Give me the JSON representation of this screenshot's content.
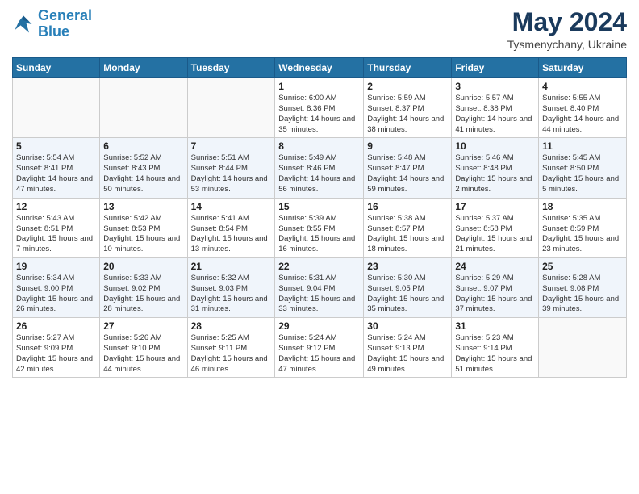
{
  "header": {
    "logo_line1": "General",
    "logo_line2": "Blue",
    "month": "May 2024",
    "location": "Tysmenychany, Ukraine"
  },
  "days_of_week": [
    "Sunday",
    "Monday",
    "Tuesday",
    "Wednesday",
    "Thursday",
    "Friday",
    "Saturday"
  ],
  "weeks": [
    [
      {
        "day": "",
        "sunrise": "",
        "sunset": "",
        "daylight": ""
      },
      {
        "day": "",
        "sunrise": "",
        "sunset": "",
        "daylight": ""
      },
      {
        "day": "",
        "sunrise": "",
        "sunset": "",
        "daylight": ""
      },
      {
        "day": "1",
        "sunrise": "Sunrise: 6:00 AM",
        "sunset": "Sunset: 8:36 PM",
        "daylight": "Daylight: 14 hours and 35 minutes."
      },
      {
        "day": "2",
        "sunrise": "Sunrise: 5:59 AM",
        "sunset": "Sunset: 8:37 PM",
        "daylight": "Daylight: 14 hours and 38 minutes."
      },
      {
        "day": "3",
        "sunrise": "Sunrise: 5:57 AM",
        "sunset": "Sunset: 8:38 PM",
        "daylight": "Daylight: 14 hours and 41 minutes."
      },
      {
        "day": "4",
        "sunrise": "Sunrise: 5:55 AM",
        "sunset": "Sunset: 8:40 PM",
        "daylight": "Daylight: 14 hours and 44 minutes."
      }
    ],
    [
      {
        "day": "5",
        "sunrise": "Sunrise: 5:54 AM",
        "sunset": "Sunset: 8:41 PM",
        "daylight": "Daylight: 14 hours and 47 minutes."
      },
      {
        "day": "6",
        "sunrise": "Sunrise: 5:52 AM",
        "sunset": "Sunset: 8:43 PM",
        "daylight": "Daylight: 14 hours and 50 minutes."
      },
      {
        "day": "7",
        "sunrise": "Sunrise: 5:51 AM",
        "sunset": "Sunset: 8:44 PM",
        "daylight": "Daylight: 14 hours and 53 minutes."
      },
      {
        "day": "8",
        "sunrise": "Sunrise: 5:49 AM",
        "sunset": "Sunset: 8:46 PM",
        "daylight": "Daylight: 14 hours and 56 minutes."
      },
      {
        "day": "9",
        "sunrise": "Sunrise: 5:48 AM",
        "sunset": "Sunset: 8:47 PM",
        "daylight": "Daylight: 14 hours and 59 minutes."
      },
      {
        "day": "10",
        "sunrise": "Sunrise: 5:46 AM",
        "sunset": "Sunset: 8:48 PM",
        "daylight": "Daylight: 15 hours and 2 minutes."
      },
      {
        "day": "11",
        "sunrise": "Sunrise: 5:45 AM",
        "sunset": "Sunset: 8:50 PM",
        "daylight": "Daylight: 15 hours and 5 minutes."
      }
    ],
    [
      {
        "day": "12",
        "sunrise": "Sunrise: 5:43 AM",
        "sunset": "Sunset: 8:51 PM",
        "daylight": "Daylight: 15 hours and 7 minutes."
      },
      {
        "day": "13",
        "sunrise": "Sunrise: 5:42 AM",
        "sunset": "Sunset: 8:53 PM",
        "daylight": "Daylight: 15 hours and 10 minutes."
      },
      {
        "day": "14",
        "sunrise": "Sunrise: 5:41 AM",
        "sunset": "Sunset: 8:54 PM",
        "daylight": "Daylight: 15 hours and 13 minutes."
      },
      {
        "day": "15",
        "sunrise": "Sunrise: 5:39 AM",
        "sunset": "Sunset: 8:55 PM",
        "daylight": "Daylight: 15 hours and 16 minutes."
      },
      {
        "day": "16",
        "sunrise": "Sunrise: 5:38 AM",
        "sunset": "Sunset: 8:57 PM",
        "daylight": "Daylight: 15 hours and 18 minutes."
      },
      {
        "day": "17",
        "sunrise": "Sunrise: 5:37 AM",
        "sunset": "Sunset: 8:58 PM",
        "daylight": "Daylight: 15 hours and 21 minutes."
      },
      {
        "day": "18",
        "sunrise": "Sunrise: 5:35 AM",
        "sunset": "Sunset: 8:59 PM",
        "daylight": "Daylight: 15 hours and 23 minutes."
      }
    ],
    [
      {
        "day": "19",
        "sunrise": "Sunrise: 5:34 AM",
        "sunset": "Sunset: 9:00 PM",
        "daylight": "Daylight: 15 hours and 26 minutes."
      },
      {
        "day": "20",
        "sunrise": "Sunrise: 5:33 AM",
        "sunset": "Sunset: 9:02 PM",
        "daylight": "Daylight: 15 hours and 28 minutes."
      },
      {
        "day": "21",
        "sunrise": "Sunrise: 5:32 AM",
        "sunset": "Sunset: 9:03 PM",
        "daylight": "Daylight: 15 hours and 31 minutes."
      },
      {
        "day": "22",
        "sunrise": "Sunrise: 5:31 AM",
        "sunset": "Sunset: 9:04 PM",
        "daylight": "Daylight: 15 hours and 33 minutes."
      },
      {
        "day": "23",
        "sunrise": "Sunrise: 5:30 AM",
        "sunset": "Sunset: 9:05 PM",
        "daylight": "Daylight: 15 hours and 35 minutes."
      },
      {
        "day": "24",
        "sunrise": "Sunrise: 5:29 AM",
        "sunset": "Sunset: 9:07 PM",
        "daylight": "Daylight: 15 hours and 37 minutes."
      },
      {
        "day": "25",
        "sunrise": "Sunrise: 5:28 AM",
        "sunset": "Sunset: 9:08 PM",
        "daylight": "Daylight: 15 hours and 39 minutes."
      }
    ],
    [
      {
        "day": "26",
        "sunrise": "Sunrise: 5:27 AM",
        "sunset": "Sunset: 9:09 PM",
        "daylight": "Daylight: 15 hours and 42 minutes."
      },
      {
        "day": "27",
        "sunrise": "Sunrise: 5:26 AM",
        "sunset": "Sunset: 9:10 PM",
        "daylight": "Daylight: 15 hours and 44 minutes."
      },
      {
        "day": "28",
        "sunrise": "Sunrise: 5:25 AM",
        "sunset": "Sunset: 9:11 PM",
        "daylight": "Daylight: 15 hours and 46 minutes."
      },
      {
        "day": "29",
        "sunrise": "Sunrise: 5:24 AM",
        "sunset": "Sunset: 9:12 PM",
        "daylight": "Daylight: 15 hours and 47 minutes."
      },
      {
        "day": "30",
        "sunrise": "Sunrise: 5:24 AM",
        "sunset": "Sunset: 9:13 PM",
        "daylight": "Daylight: 15 hours and 49 minutes."
      },
      {
        "day": "31",
        "sunrise": "Sunrise: 5:23 AM",
        "sunset": "Sunset: 9:14 PM",
        "daylight": "Daylight: 15 hours and 51 minutes."
      },
      {
        "day": "",
        "sunrise": "",
        "sunset": "",
        "daylight": ""
      }
    ]
  ]
}
